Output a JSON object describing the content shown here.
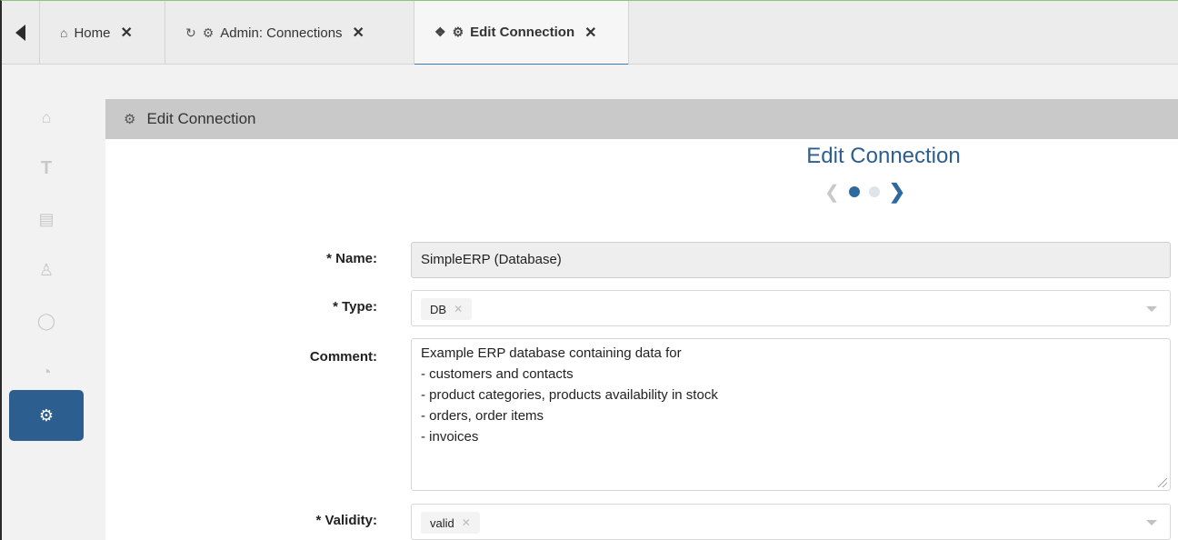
{
  "tabs": [
    {
      "label": "Home",
      "icon": "home-icon"
    },
    {
      "label": "Admin: Connections",
      "icon": "refresh-icon"
    },
    {
      "label": "Edit Connection",
      "icon": "pin-icon"
    }
  ],
  "sidebar": {
    "items": [
      {
        "icon": "home-icon"
      },
      {
        "icon": "text-icon"
      },
      {
        "icon": "database-icon"
      },
      {
        "icon": "users-icon"
      },
      {
        "icon": "lightbulb-icon"
      },
      {
        "icon": "pie-chart-icon"
      },
      {
        "icon": "user-settings-icon",
        "active": true
      }
    ]
  },
  "panel": {
    "header": "Edit Connection",
    "title": "Edit Connection"
  },
  "form": {
    "name_label": "* Name:",
    "name_value": "SimpleERP (Database)",
    "type_label": "* Type:",
    "type_value": "DB",
    "comment_label": "Comment:",
    "comment_lines": [
      "Example ERP database containing data for",
      "- customers and contacts",
      "- product categories, products availability in stock",
      "- orders, order items",
      "- invoices"
    ],
    "validity_label": "* Validity:",
    "validity_value": "valid"
  },
  "colors": {
    "accent": "#2c5f8f",
    "active_tab_underline": "#3d7ab5",
    "panel_header": "#c9c9c9"
  }
}
